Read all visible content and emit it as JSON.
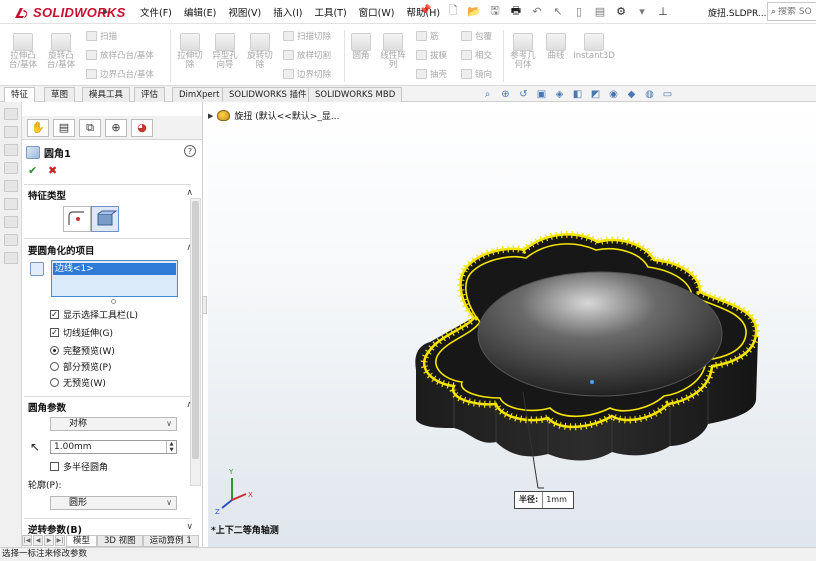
{
  "app": {
    "brand": "SOLIDWORKS",
    "menu_arrow": "▶",
    "menus": [
      "文件(F)",
      "编辑(E)",
      "视图(V)",
      "插入(I)",
      "工具(T)",
      "窗口(W)",
      "帮助(H)"
    ],
    "document_title": "旋扭.SLDPR...",
    "search_placeholder": "搜索 SO",
    "brand_color": "#c8102e"
  },
  "ribbon": {
    "large": [
      {
        "name": "extrude-boss",
        "label": "拉伸凸\n台/基体"
      },
      {
        "name": "revolve-boss",
        "label": "旋转凸\n台/基体"
      },
      {
        "name": "extruded-cut",
        "label": "拉伸切\n除"
      },
      {
        "name": "hole-wizard",
        "label": "异型孔\n向导"
      },
      {
        "name": "revolved-cut",
        "label": "旋转切\n除"
      },
      {
        "name": "fillet",
        "label": "圆角"
      },
      {
        "name": "linear-pattern",
        "label": "线性阵\n列"
      },
      {
        "name": "reference-geometry",
        "label": "参考几\n何体"
      },
      {
        "name": "curves",
        "label": "曲线"
      },
      {
        "name": "instant3d",
        "label": "Instant3D"
      }
    ],
    "small": [
      {
        "name": "sweep",
        "label": "扫描"
      },
      {
        "name": "loft-boss",
        "label": "放样凸台/基体"
      },
      {
        "name": "boundary-boss",
        "label": "边界凸台/基体"
      },
      {
        "name": "swept-cut",
        "label": "扫描切除"
      },
      {
        "name": "lofted-cut",
        "label": "放样切割"
      },
      {
        "name": "boundary-cut",
        "label": "边界切除"
      },
      {
        "name": "rib",
        "label": "筋"
      },
      {
        "name": "draft",
        "label": "拔模"
      },
      {
        "name": "shell",
        "label": "抽壳"
      },
      {
        "name": "wrap",
        "label": "包覆"
      },
      {
        "name": "intersect",
        "label": "相交"
      },
      {
        "name": "mirror",
        "label": "镜向"
      }
    ]
  },
  "tabs": [
    "特征",
    "草图",
    "模具工具",
    "评估",
    "DimXpert",
    "SOLIDWORKS 插件",
    "SOLIDWORKS MBD"
  ],
  "property_manager": {
    "title": "圆角1",
    "help": "?",
    "ok": "✔",
    "cancel": "✖",
    "section_feature_type": "特征类型",
    "section_items": "要圆角化的项目",
    "selected_item": "边线<1>",
    "show_toolbar": "显示选择工具栏(L)",
    "tangent_propagation": "切线延伸(G)",
    "full_preview": "完整预览(W)",
    "partial_preview": "部分预览(P)",
    "no_preview": "无预览(W)",
    "section_params": "圆角参数",
    "symmetric": "对称",
    "radius_value": "1.00mm",
    "multi_radius": "多半径圆角",
    "profile_label": "轮廓(P):",
    "profile_value": "圆形",
    "section_setback": "逆转参数(B)",
    "check_mark": "✓",
    "caret": "∧",
    "dropdown_arrow": "∨"
  },
  "bottom_tabs": [
    "模型",
    "3D 视图",
    "运动算例 1"
  ],
  "status": "选择一标注来修改参数",
  "viewport": {
    "tree_label": "旋扭  (默认<<默认>_显...",
    "view_name": "*上下二等角轴测",
    "callout_label": "半径:",
    "callout_value": "1mm",
    "triad_x": "X",
    "triad_y": "Y",
    "triad_z": "Z",
    "accent": "#f5e400"
  }
}
